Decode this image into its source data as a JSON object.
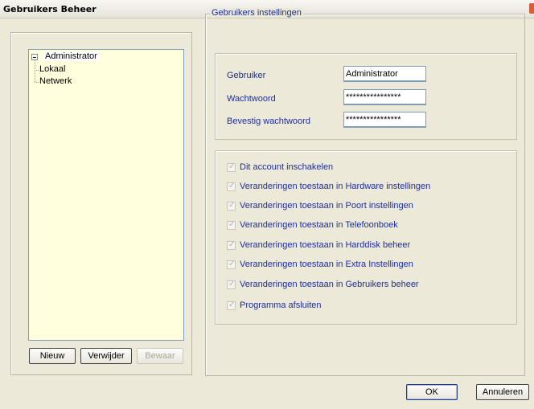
{
  "window": {
    "title": "Gebruikers Beheer"
  },
  "tree": {
    "root": "Administrator",
    "children": [
      "Lokaal",
      "Netwerk"
    ]
  },
  "left_buttons": {
    "new": "Nieuw",
    "delete": "Verwijder",
    "save": "Bewaar"
  },
  "settings": {
    "legend": "Gebruikers instellingen",
    "fields": {
      "user_label": "Gebruiker",
      "user_value": "Administrator",
      "password_label": "Wachtwoord",
      "password_value": "****************",
      "confirm_label": "Bevestig wachtwoord",
      "confirm_value": "****************"
    },
    "permissions": [
      {
        "label": "Dit account inschakelen",
        "checked": true
      },
      {
        "label": "Veranderingen toestaan in Hardware instellingen",
        "checked": true
      },
      {
        "label": "Veranderingen toestaan in Poort instellingen",
        "checked": true
      },
      {
        "label": "Veranderingen toestaan in Telefoonboek",
        "checked": true
      },
      {
        "label": "Veranderingen toestaan in Harddisk beheer",
        "checked": true
      },
      {
        "label": "Veranderingen toestaan in Extra Instellingen",
        "checked": true
      },
      {
        "label": "Veranderingen toestaan in Gebruikers beheer",
        "checked": true
      },
      {
        "label": "Programma afsluiten",
        "checked": true
      }
    ]
  },
  "dialog_buttons": {
    "ok": "OK",
    "cancel": "Annuleren"
  },
  "colors": {
    "label_text": "#1c2da0",
    "tree_background": "#ffffdd",
    "window_background": "#ece9d8"
  }
}
